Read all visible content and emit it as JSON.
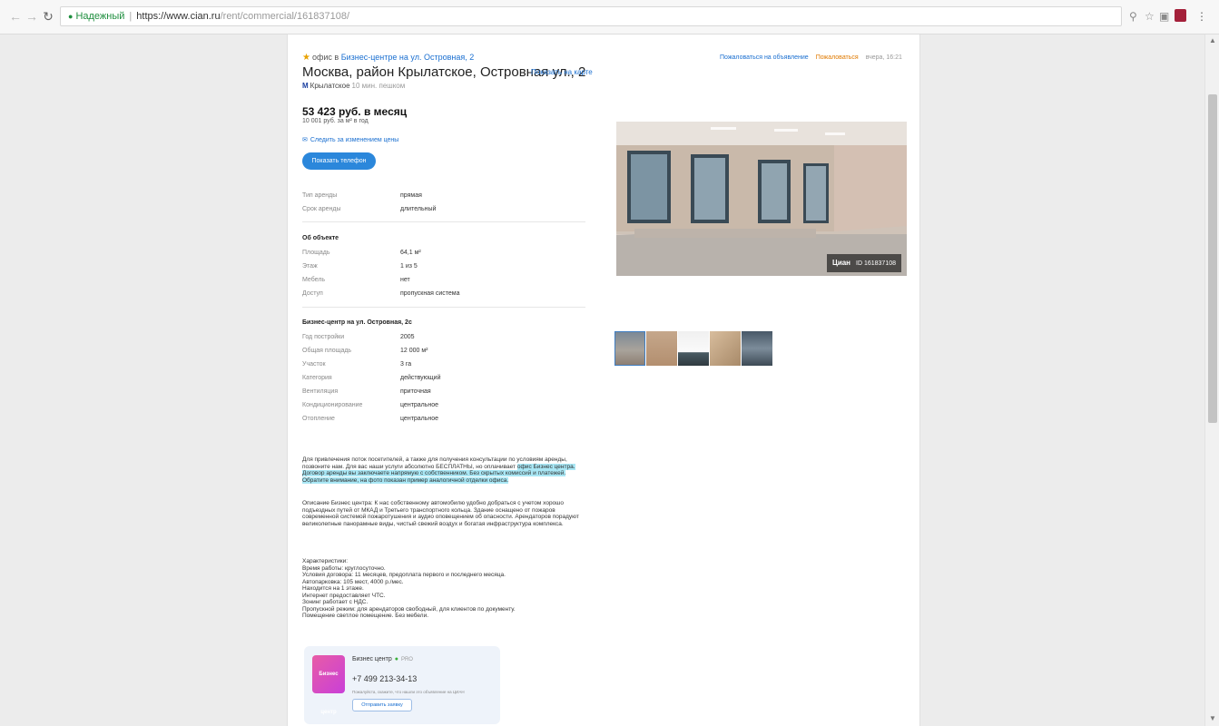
{
  "browser": {
    "secure_label": "Надежный",
    "url_host": "https://www.cian.ru",
    "url_path": "/rent/commercial/161837108/"
  },
  "listing": {
    "breadcrumb_prefix": "офис в",
    "breadcrumb_link": "Бизнес-центре на ул. Островная, 2",
    "address": "Москва, район Крылатское, Островная ул., 2",
    "map_link": "Показать на карте",
    "metro_station": "Крылатское",
    "metro_distance": "10 мин. пешком",
    "compare_link": "Пожаловаться на объявление",
    "complain_link": "Пожаловаться",
    "date": "вчера, 16:21",
    "price": "53 423 руб. в месяц",
    "price_per_m": "10 001 руб. за м² в год",
    "price_watch": "Следить за изменением цены",
    "show_phone": "Показать телефон"
  },
  "terms": [
    {
      "k": "Тип аренды",
      "v": "прямая"
    },
    {
      "k": "Срок аренды",
      "v": "длительный"
    }
  ],
  "object_section": {
    "title": "Об объекте",
    "rows": [
      {
        "k": "Площадь",
        "v": "64,1 м²"
      },
      {
        "k": "Этаж",
        "v": "1 из 5"
      },
      {
        "k": "Мебель",
        "v": "нет"
      },
      {
        "k": "Доступ",
        "v": "пропускная система"
      }
    ]
  },
  "building_section": {
    "title": "Бизнес-центр на ул. Островная, 2с",
    "rows": [
      {
        "k": "Год постройки",
        "v": "2005"
      },
      {
        "k": "Общая площадь",
        "v": "12 000 м²"
      },
      {
        "k": "Участок",
        "v": "3 га"
      },
      {
        "k": "Категория",
        "v": "действующий"
      },
      {
        "k": "Вентиляция",
        "v": "приточная"
      },
      {
        "k": "Кондиционирование",
        "v": "центральное"
      },
      {
        "k": "Отопление",
        "v": "центральное"
      }
    ]
  },
  "description": {
    "p1_plain": "Для привлечения поток посетителей, а также для получения консультации по условиям аренды, позвоните нам. Для вас наши услуги абсолютно БЕСПЛАТНЫ, но оплачивает ",
    "p1_highlight": "офис Бизнес центра. Договор аренды вы заключаете напрямую с собственником. Без скрытых комиссий и платежей. Обратите внимание, на фото показан пример аналогичной отделки офиса.",
    "p2": "Описание Бизнес центра: К нас собственному автомобилю удобно добраться с учетом хорошо подъездных путей от МКАД и Третьего транспортного кольца. Здание оснащено от пожаров современной системой пожаротушения и аудио оповещением об опасности. Арендаторов порадуют великолепные панорамные виды, чистый свежий воздух и богатая инфраструктура комплекса.",
    "p3": "Характеристики:\nВремя работы: круглосуточно.\nУсловия договора: 11 месяцев, предоплата первого и последнего месяца.\nАвтопарковка: 105 мест, 4000 р./мес.\nНаходится на 1 этаже.\nИнтернет предоставляет ЧТС.\nЗонинг работает с НДС.\nПропускной режим: для арендаторов свободный, для клиентов по документу.\nПомещение светлое помещение. Без мебели."
  },
  "agent": {
    "logo_text": "Бизнес центр",
    "name": "Бизнес центр",
    "tag": "PRO",
    "phone": "+7 499 213-34-13",
    "note": "Пожалуйста, скажите, что нашли это объявление на ЦИАН",
    "button": "Отправить заявку"
  },
  "photo": {
    "brand": "Циан",
    "id_text": "ID 161837108"
  },
  "icons": {
    "star": "★",
    "metro": "M",
    "bell": "bell-icon",
    "pin": "location-pin-icon"
  },
  "colors": {
    "accent": "#2b87db",
    "link": "#1a6fd0",
    "highlight": "#a9e7f5",
    "complain": "#e07a00"
  }
}
